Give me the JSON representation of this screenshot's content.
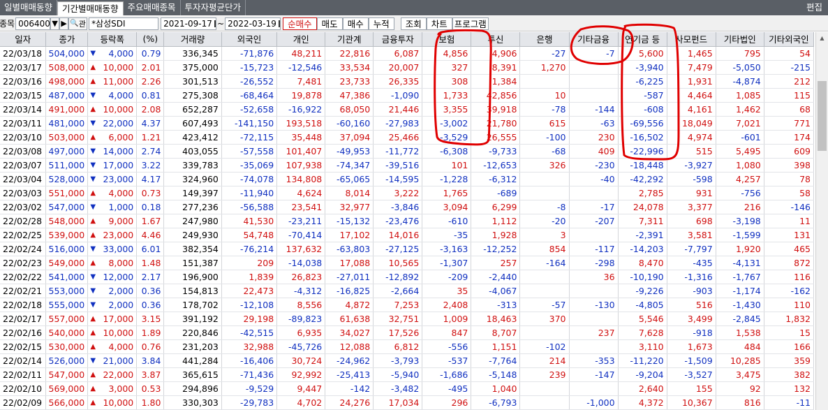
{
  "tabs": [
    {
      "label": "일별매매동향",
      "active": false
    },
    {
      "label": "기간별매매동향",
      "active": true
    },
    {
      "label": "주요매매종목",
      "active": false
    },
    {
      "label": "투자자평균단가",
      "active": false
    }
  ],
  "edit_label": "편집",
  "toolbar": {
    "stock_label": "종목",
    "stock_code": "006400",
    "stock_name": "*삼성SDI",
    "search_btn": "관",
    "date_from": "2021-09-17",
    "date_to": "2022-03-19",
    "tilde": "~",
    "modes": [
      "순매수",
      "매도",
      "매수",
      "누적"
    ],
    "active_mode": "순매수",
    "query_btn": "조회",
    "chart_btn": "차트",
    "program_btn": "프로그램"
  },
  "columns": [
    "일자",
    "종가",
    "등락폭",
    "(%)",
    "거래량",
    "외국인",
    "개인",
    "기관계",
    "금융투자",
    "보험",
    "투신",
    "은행",
    "기타금융",
    "연기금 등",
    "사모펀드",
    "기타법인",
    "기타외국인"
  ],
  "rows": [
    [
      "22/03/18",
      "504,000",
      "down",
      "4,000",
      "0.79",
      "336,345",
      "-71,876",
      "48,211",
      "22,816",
      "6,087",
      "4,856",
      "4,906",
      "-27",
      "-7",
      "5,600",
      "1,465",
      "795",
      "54"
    ],
    [
      "22/03/17",
      "508,000",
      "up",
      "10,000",
      "2.01",
      "375,000",
      "-15,723",
      "-12,546",
      "33,534",
      "20,007",
      "327",
      "8,391",
      "1,270",
      "",
      "-3,940",
      "7,479",
      "-5,050",
      "-215"
    ],
    [
      "22/03/16",
      "498,000",
      "up",
      "11,000",
      "2.26",
      "301,513",
      "-26,552",
      "7,481",
      "23,733",
      "26,335",
      "308",
      "1,384",
      "",
      "",
      "-6,225",
      "1,931",
      "-4,874",
      "212"
    ],
    [
      "22/03/15",
      "487,000",
      "down",
      "4,000",
      "0.81",
      "275,308",
      "-68,464",
      "19,878",
      "47,386",
      "-1,090",
      "1,733",
      "42,856",
      "10",
      "",
      "-587",
      "4,464",
      "1,085",
      "115"
    ],
    [
      "22/03/14",
      "491,000",
      "up",
      "10,000",
      "2.08",
      "652,287",
      "-52,658",
      "-16,922",
      "68,050",
      "21,446",
      "3,355",
      "39,918",
      "-78",
      "-144",
      "-608",
      "4,161",
      "1,462",
      "68"
    ],
    [
      "22/03/11",
      "481,000",
      "down",
      "22,000",
      "4.37",
      "607,493",
      "-141,150",
      "193,518",
      "-60,160",
      "-27,983",
      "-3,002",
      "21,780",
      "615",
      "-63",
      "-69,556",
      "18,049",
      "7,021",
      "771"
    ],
    [
      "22/03/10",
      "503,000",
      "up",
      "6,000",
      "1.21",
      "423,412",
      "-72,115",
      "35,448",
      "37,094",
      "25,466",
      "-3,529",
      "26,555",
      "-100",
      "230",
      "-16,502",
      "4,974",
      "-601",
      "174"
    ],
    [
      "22/03/08",
      "497,000",
      "down",
      "14,000",
      "2.74",
      "403,055",
      "-57,558",
      "101,407",
      "-49,953",
      "-11,772",
      "-6,308",
      "-9,733",
      "-68",
      "409",
      "-22,996",
      "515",
      "5,495",
      "609"
    ],
    [
      "22/03/07",
      "511,000",
      "down",
      "17,000",
      "3.22",
      "339,783",
      "-35,069",
      "107,938",
      "-74,347",
      "-39,516",
      "101",
      "-12,653",
      "326",
      "-230",
      "-18,448",
      "-3,927",
      "1,080",
      "398"
    ],
    [
      "22/03/04",
      "528,000",
      "down",
      "23,000",
      "4.17",
      "324,960",
      "-74,078",
      "134,808",
      "-65,065",
      "-14,595",
      "-1,228",
      "-6,312",
      "",
      "-40",
      "-42,292",
      "-598",
      "4,257",
      "78"
    ],
    [
      "22/03/03",
      "551,000",
      "up",
      "4,000",
      "0.73",
      "149,397",
      "-11,940",
      "4,624",
      "8,014",
      "3,222",
      "1,765",
      "-689",
      "",
      "",
      "2,785",
      "931",
      "-756",
      "58"
    ],
    [
      "22/03/02",
      "547,000",
      "down",
      "1,000",
      "0.18",
      "277,236",
      "-56,588",
      "23,541",
      "32,977",
      "-3,846",
      "3,094",
      "6,299",
      "-8",
      "-17",
      "24,078",
      "3,377",
      "216",
      "-146"
    ],
    [
      "22/02/28",
      "548,000",
      "up",
      "9,000",
      "1.67",
      "247,980",
      "41,530",
      "-23,211",
      "-15,132",
      "-23,476",
      "-610",
      "1,112",
      "-20",
      "-207",
      "7,311",
      "698",
      "-3,198",
      "11"
    ],
    [
      "22/02/25",
      "539,000",
      "up",
      "23,000",
      "4.46",
      "249,930",
      "54,748",
      "-70,414",
      "17,102",
      "14,016",
      "-35",
      "1,928",
      "3",
      "",
      "-2,391",
      "3,581",
      "-1,599",
      "131"
    ],
    [
      "22/02/24",
      "516,000",
      "down",
      "33,000",
      "6.01",
      "382,354",
      "-76,214",
      "137,632",
      "-63,803",
      "-27,125",
      "-3,163",
      "-12,252",
      "854",
      "-117",
      "-14,203",
      "-7,797",
      "1,920",
      "465"
    ],
    [
      "22/02/23",
      "549,000",
      "up",
      "8,000",
      "1.48",
      "151,387",
      "209",
      "-14,038",
      "17,088",
      "10,565",
      "-1,307",
      "257",
      "-164",
      "-298",
      "8,470",
      "-435",
      "-4,131",
      "872"
    ],
    [
      "22/02/22",
      "541,000",
      "down",
      "12,000",
      "2.17",
      "196,900",
      "1,839",
      "26,823",
      "-27,011",
      "-12,892",
      "-209",
      "-2,440",
      "",
      "36",
      "-10,190",
      "-1,316",
      "-1,767",
      "116"
    ],
    [
      "22/02/21",
      "553,000",
      "down",
      "2,000",
      "0.36",
      "154,813",
      "22,473",
      "-4,312",
      "-16,825",
      "-2,664",
      "35",
      "-4,067",
      "",
      "",
      "-9,226",
      "-903",
      "-1,174",
      "-162"
    ],
    [
      "22/02/18",
      "555,000",
      "down",
      "2,000",
      "0.36",
      "178,702",
      "-12,108",
      "8,556",
      "4,872",
      "7,253",
      "2,408",
      "-313",
      "-57",
      "-130",
      "-4,805",
      "516",
      "-1,430",
      "110"
    ],
    [
      "22/02/17",
      "557,000",
      "up",
      "17,000",
      "3.15",
      "391,192",
      "29,198",
      "-89,823",
      "61,638",
      "32,751",
      "1,009",
      "18,463",
      "370",
      "",
      "5,546",
      "3,499",
      "-2,845",
      "1,832"
    ],
    [
      "22/02/16",
      "540,000",
      "up",
      "10,000",
      "1.89",
      "220,846",
      "-42,515",
      "6,935",
      "34,027",
      "17,526",
      "847",
      "8,707",
      "",
      "237",
      "7,628",
      "-918",
      "1,538",
      "15"
    ],
    [
      "22/02/15",
      "530,000",
      "up",
      "4,000",
      "0.76",
      "231,203",
      "32,988",
      "-45,726",
      "12,088",
      "6,812",
      "-556",
      "1,151",
      "-102",
      "",
      "3,110",
      "1,673",
      "484",
      "166"
    ],
    [
      "22/02/14",
      "526,000",
      "down",
      "21,000",
      "3.84",
      "441,284",
      "-16,406",
      "30,724",
      "-24,962",
      "-3,793",
      "-537",
      "-7,764",
      "214",
      "-353",
      "-11,220",
      "-1,509",
      "10,285",
      "359"
    ],
    [
      "22/02/11",
      "547,000",
      "up",
      "22,000",
      "3.87",
      "365,615",
      "-71,436",
      "92,992",
      "-25,413",
      "-5,940",
      "-1,686",
      "-5,148",
      "239",
      "-147",
      "-9,204",
      "-3,527",
      "3,475",
      "382"
    ],
    [
      "22/02/10",
      "569,000",
      "up",
      "3,000",
      "0.53",
      "294,896",
      "-9,529",
      "9,447",
      "-142",
      "-3,482",
      "-495",
      "1,040",
      "",
      "",
      "2,640",
      "155",
      "92",
      "132"
    ],
    [
      "22/02/09",
      "566,000",
      "up",
      "10,000",
      "1.80",
      "330,303",
      "-29,783",
      "4,702",
      "24,276",
      "17,034",
      "296",
      "-6,793",
      "",
      "-1,000",
      "4,372",
      "10,367",
      "816",
      "-11"
    ]
  ],
  "colors": {
    "up": "#d01010",
    "down": "#1030c0",
    "annotation": "#e00000"
  }
}
